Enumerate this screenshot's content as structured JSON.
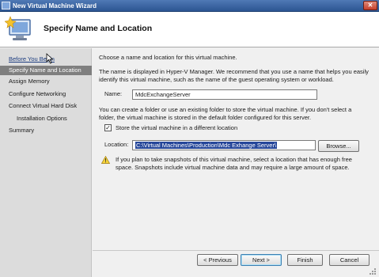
{
  "window": {
    "title": "New Virtual Machine Wizard",
    "close_symbol": "✕"
  },
  "header": {
    "title": "Specify Name and Location",
    "icon": "virtual-machine-wizard-icon"
  },
  "nav": {
    "items": [
      {
        "label": "Before You Begin",
        "state": "link"
      },
      {
        "label": "Specify Name and Location",
        "state": "active"
      },
      {
        "label": "Assign Memory",
        "state": "normal"
      },
      {
        "label": "Configure Networking",
        "state": "normal"
      },
      {
        "label": "Connect Virtual Hard Disk",
        "state": "normal"
      },
      {
        "label": "Installation Options",
        "state": "sub"
      },
      {
        "label": "Summary",
        "state": "normal"
      }
    ]
  },
  "content": {
    "intro": "Choose a name and location for this virtual machine.",
    "name_help_line1": "The name is displayed in Hyper-V Manager. We recommend that you use a name that helps you easily",
    "name_help_line2": "identify this virtual machine, such as the name of the guest operating system or workload.",
    "name_label": "Name:",
    "name_value": "MdcExchangeServer",
    "folder_help_line1": "You can create a folder or use an existing folder to store the virtual machine. If you don't select a",
    "folder_help_line2": "folder, the virtual machine is stored in the default folder configured for this server.",
    "store_checkbox_label": "Store the virtual machine in a different location",
    "store_checked": true,
    "location_label": "Location:",
    "location_value": "C:\\Virtual Machines\\Production\\Mdc Exhange Server\\",
    "browse_label": "Browse...",
    "warning_line1": "If you plan to take snapshots of this virtual machine, select a location that has enough free",
    "warning_line2": "space. Snapshots include virtual machine data and may require a large amount of space."
  },
  "buttons": {
    "previous": "< Previous",
    "next": "Next >",
    "finish": "Finish",
    "cancel": "Cancel"
  },
  "colors": {
    "titlebar": "#2c5592",
    "nav_active": "#7f7f7f",
    "selection": "#26479a",
    "link": "#1d3d80"
  }
}
